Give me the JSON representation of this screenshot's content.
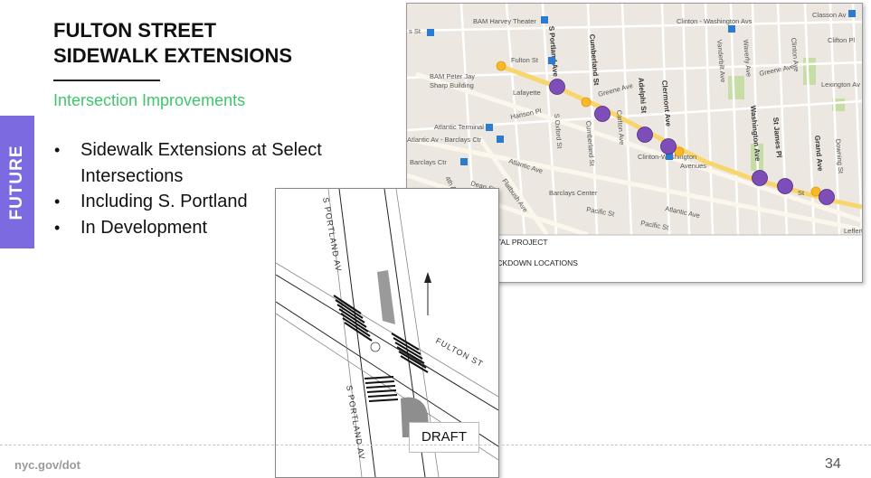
{
  "side_tab": {
    "label": "FUTURE",
    "color": "#7b6ae0"
  },
  "title": {
    "line1": "FULTON STREET",
    "line2": "SIDEWALK EXTENSIONS"
  },
  "subtitle": "Intersection Improvements",
  "accent_color": "#3ec66b",
  "bullets": [
    {
      "text": "Sidewalk Extensions at Select Intersections"
    },
    {
      "text": "Including S. Portland"
    },
    {
      "text": "In Development"
    }
  ],
  "footer": {
    "url": "nyc.gov/dot",
    "page": "34"
  },
  "map": {
    "labels": {
      "bam_harvey": "BAM Harvey Theater",
      "clinton_washington_top": "Clinton - Washington Avs",
      "classon": "Classon Av",
      "st_left": "s St",
      "fulton_st": "Fulton St",
      "bam_peter_jay": "BAM Peter Jay",
      "sharp_building": "Sharp Building",
      "lafayette": "Lafayette",
      "greene_ave_1": "Greene Ave",
      "greene_ave_2": "Greene Ave",
      "hanson_pl": "Hanson Pl",
      "atlantic_terminal": "Atlantic Terminal",
      "atlantic_barclays": "Atlantic Av - Barclays Ctr",
      "barclays_left": "Barclays Ctr",
      "atlantic_ave_1": "Atlantic Ave",
      "atlantic_ave_2": "Atlantic Ave",
      "dean_st": "Dean St",
      "flatbush_ave": "Flatbush Ave",
      "fourth_ave": "4th Ave",
      "barclays_center": "Barclays Center",
      "pacific_st_1": "Pacific St",
      "pacific_st_2": "Pacific St",
      "s_portland": "S Portland Ave",
      "cumberland_st": "Cumberland St",
      "s_oxford": "S Oxford St",
      "carlton": "Carlton Ave",
      "adelphi": "Adelphi St",
      "clermont": "Clermont Ave",
      "vanderbilt": "Vanderbilt Ave",
      "waverly": "Waverly Ave",
      "washington": "Washington Ave",
      "st_james": "St James Pl",
      "grand": "Grand Ave",
      "downing": "Downing St",
      "clinton_ave": "Clinton Ave",
      "clifton": "Clifton Pl",
      "lexington": "Lexington Av",
      "clinton_washington_avenues_1": "Clinton-Washington",
      "clinton_washington_avenues_2": "Avenues",
      "st_short": "St",
      "lefferts": "Lefferts",
      "fulton_f": "F",
      "fulton_st_short": "St"
    },
    "legend": [
      {
        "label": "EXISTING CAPITAL PROJECT",
        "color": "#f7b928"
      },
      {
        "label": "PROPOSED NECKDOWN LOCATIONS",
        "color": "#7d4db8"
      }
    ]
  },
  "drawing": {
    "street_s_portland_top": "S PORTLAND AV",
    "street_s_portland_bottom": "S PORTLAND AV",
    "street_fulton": "FULTON ST",
    "draft": "DRAFT"
  }
}
